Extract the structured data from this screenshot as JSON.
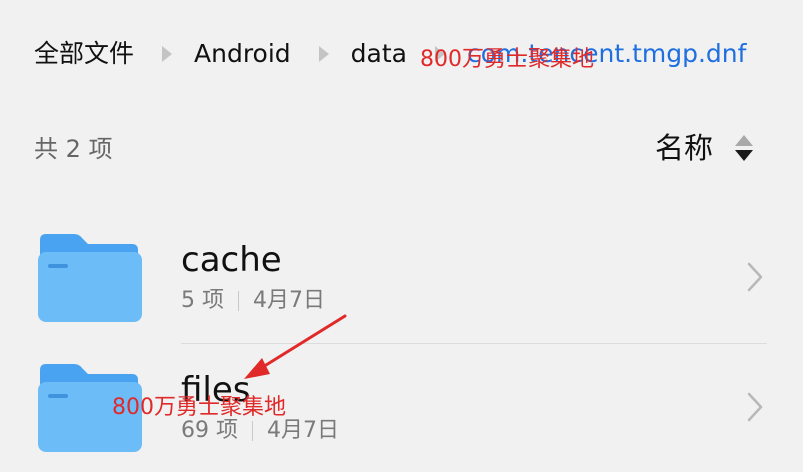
{
  "breadcrumb": {
    "items": [
      {
        "label": "全部文件"
      },
      {
        "label": "Android"
      },
      {
        "label": "data"
      },
      {
        "label": "com.tencent.tmgp.dnf"
      }
    ]
  },
  "summary": {
    "count_label": "共 2 项"
  },
  "sort": {
    "label": "名称",
    "icon": "sort-up-down-icon"
  },
  "files": [
    {
      "name": "cache",
      "items": "5 项",
      "date": "4月7日",
      "icon": "folder-icon"
    },
    {
      "name": "files",
      "items": "69 项",
      "date": "4月7日",
      "icon": "folder-icon"
    }
  ],
  "watermarks": {
    "top": "800万勇士聚集地",
    "bottom": "800万勇士聚集地"
  },
  "colors": {
    "background": "#f1f1f1",
    "current_crumb": "#1f6fe0",
    "folder_back": "#4aa3f0",
    "folder_front": "#6cbcf8",
    "annotation": "#e02a2a"
  }
}
